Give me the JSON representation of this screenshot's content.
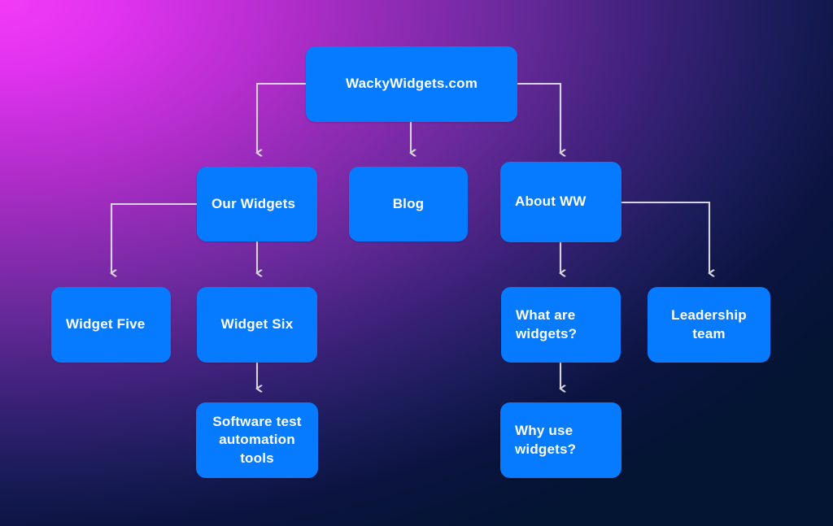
{
  "diagram": {
    "type": "sitemap-tree",
    "title_node": "WackyWidgets.com",
    "colors": {
      "node_fill": "#077bff",
      "node_text": "#ffffff",
      "connector": "#d8d4dc",
      "background_start": "#ee33f5",
      "background_end": "#021c4e"
    },
    "nodes": [
      {
        "id": "root",
        "label": "WackyWidgets.com",
        "level": 0,
        "align": "center"
      },
      {
        "id": "our-widgets",
        "label": "Our Widgets",
        "level": 1,
        "align": "left"
      },
      {
        "id": "blog",
        "label": "Blog",
        "level": 1,
        "align": "center"
      },
      {
        "id": "about-ww",
        "label": "About WW",
        "level": 1,
        "align": "left"
      },
      {
        "id": "widget-five",
        "label": "Widget Five",
        "level": 2,
        "align": "left"
      },
      {
        "id": "widget-six",
        "label": "Widget Six",
        "level": 2,
        "align": "center"
      },
      {
        "id": "what-are",
        "label": "What are widgets?",
        "level": 2,
        "align": "left"
      },
      {
        "id": "leadership",
        "label": "Leadership team",
        "level": 2,
        "align": "center"
      },
      {
        "id": "software",
        "label": "Software test automation tools",
        "level": 3,
        "align": "center"
      },
      {
        "id": "why-use",
        "label": "Why use widgets?",
        "level": 3,
        "align": "left"
      }
    ],
    "edges": [
      {
        "from": "root",
        "to": "our-widgets"
      },
      {
        "from": "root",
        "to": "blog"
      },
      {
        "from": "root",
        "to": "about-ww"
      },
      {
        "from": "our-widgets",
        "to": "widget-five"
      },
      {
        "from": "our-widgets",
        "to": "widget-six"
      },
      {
        "from": "about-ww",
        "to": "what-are"
      },
      {
        "from": "about-ww",
        "to": "leadership"
      },
      {
        "from": "widget-six",
        "to": "software"
      },
      {
        "from": "what-are",
        "to": "why-use"
      }
    ]
  }
}
